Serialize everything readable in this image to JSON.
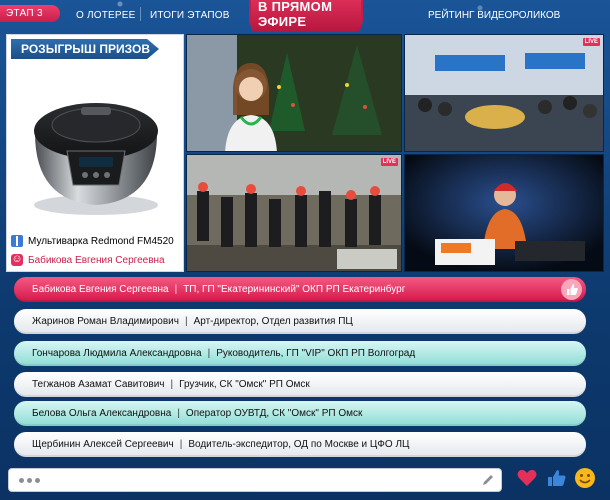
{
  "nav": {
    "stage": "ЭТАП 3",
    "about": "О ЛОТЕРЕЕ",
    "results": "ИТОГИ ЭТАПОВ",
    "live": "В ПРЯМОМ ЭФИРЕ",
    "rating": "РЕЙТИНГ ВИДЕОРОЛИКОВ"
  },
  "prize": {
    "title": "РОЗЫГРЫШ ПРИЗОВ",
    "item": "Мультиварка Redmond FM4520",
    "winner": "Бабикова Евгения Сергеевна",
    "icons": [
      "gift-icon",
      "smile-icon"
    ]
  },
  "cameras": [
    {
      "name": "host-camera",
      "live": false
    },
    {
      "name": "office-camera",
      "live": true,
      "live_label": "LIVE",
      "sign": "Консе"
    },
    {
      "name": "party-camera",
      "live": true,
      "live_label": "LIVE"
    },
    {
      "name": "dj-camera",
      "live": false,
      "sign": "Консе"
    }
  ],
  "participants": [
    {
      "name": "Бабикова Евгения Сергеевна",
      "info": "ТП, ГП \"Екатерининский\" ОКП РП Екатеринбург",
      "style": "pink"
    },
    {
      "name": "Жаринов Роман Владимирович",
      "info": "Арт-директор, Отдел развития ПЦ",
      "style": "grey"
    },
    {
      "name": "Гончарова Людмила Александровна",
      "info": "Руководитель, ГП \"VIP\" ОКП РП Волгоград",
      "style": "teal"
    },
    {
      "name": "Тегжанов Азамат Савитович",
      "info": "Грузчик, СК \"Омск\" РП Омск",
      "style": "grey"
    },
    {
      "name": "Белова Ольга Александровна",
      "info": "Оператор ОУВТД, СК \"Омск\" РП Омск",
      "style": "teal"
    },
    {
      "name": "Щербинин Алексей Сергеевич",
      "info": "Водитель-экспедитор, ОД по Москве и ЦФО ЛЦ",
      "style": "grey"
    }
  ],
  "separator": "|",
  "colors": {
    "accent_pink": "#e2305a",
    "brand_blue": "#1b4f8a",
    "like_blue": "#3b86d8",
    "smile_yellow": "#f6b81a"
  },
  "bottom": {
    "input_value": "",
    "actions": [
      "heart-icon",
      "thumbs-up-icon",
      "smile-icon"
    ]
  }
}
